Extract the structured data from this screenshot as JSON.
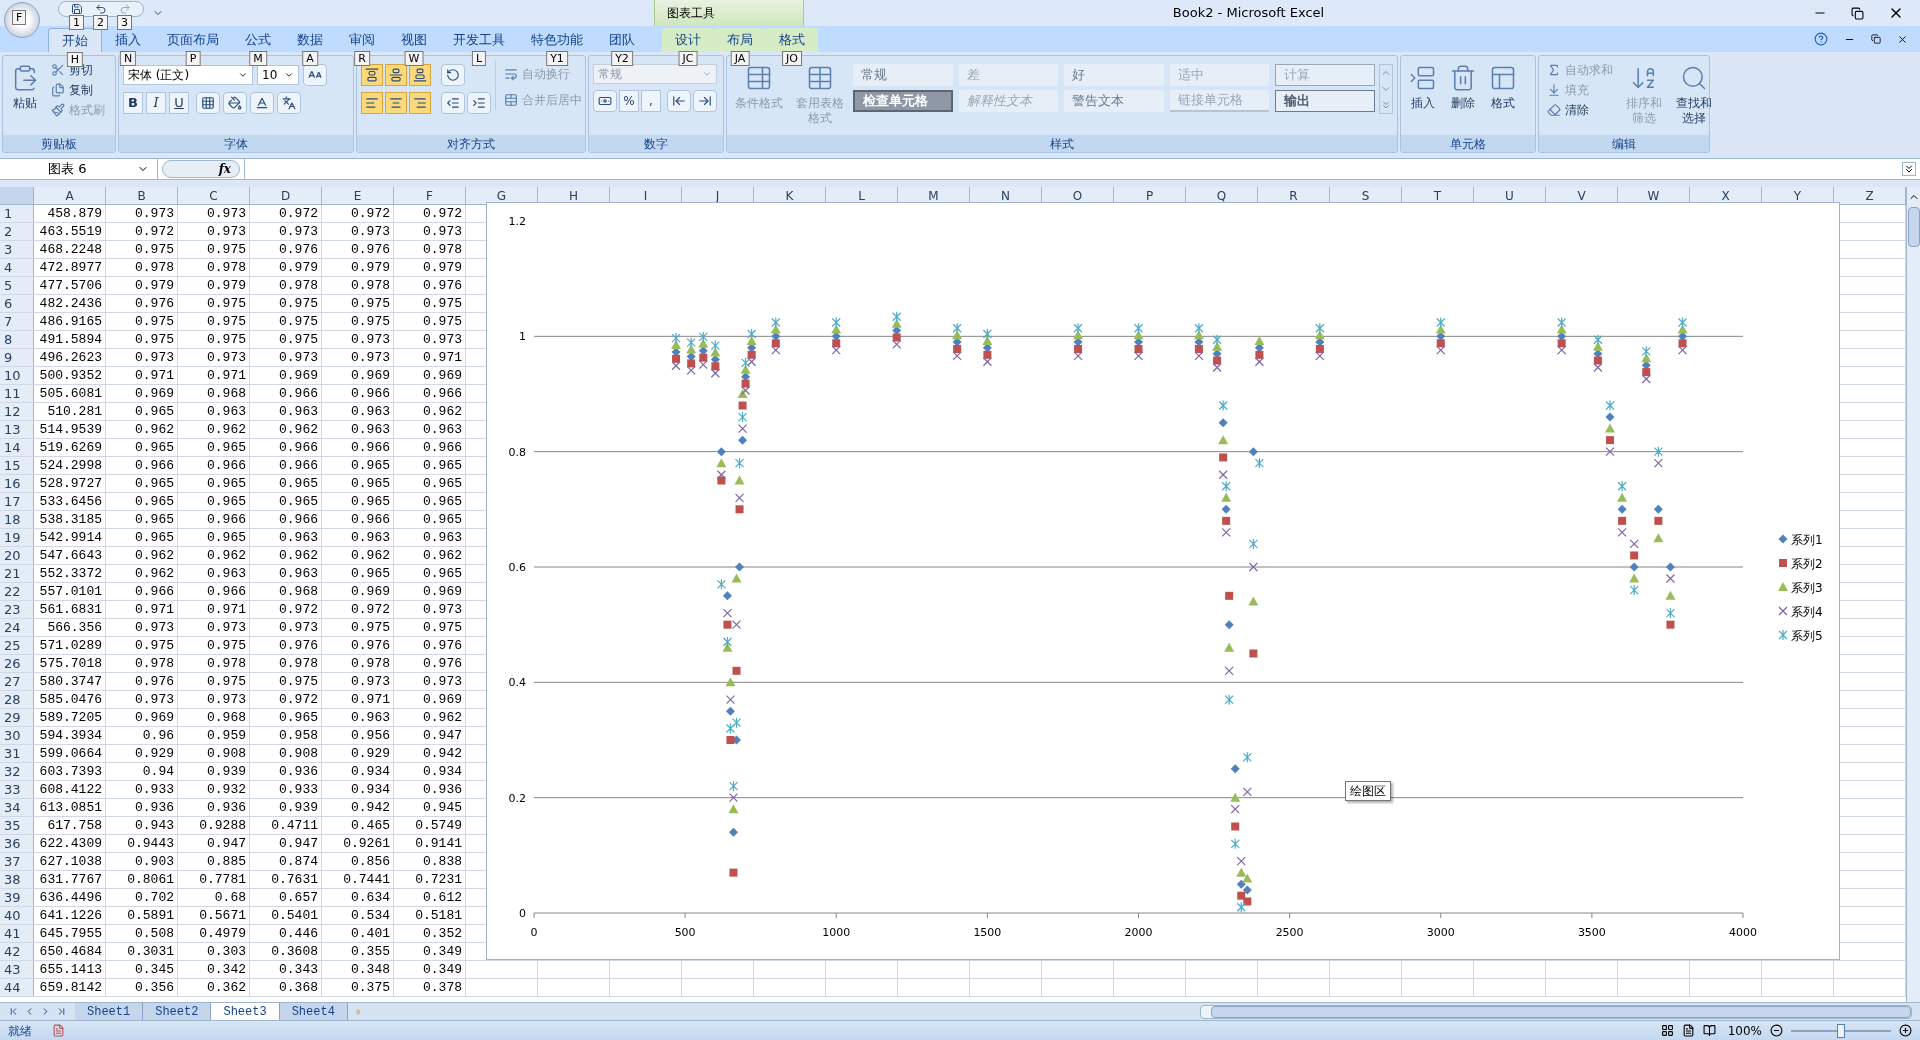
{
  "office_button": {
    "keytip": "F"
  },
  "quick_access": {
    "keytips": [
      "1",
      "2",
      "3"
    ]
  },
  "window": {
    "title": "Book2 - Microsoft Excel",
    "context_group": "图表工具"
  },
  "ribbon_tabs": [
    {
      "label": "开始",
      "keytip": "H",
      "selected": true,
      "contextual": false
    },
    {
      "label": "插入",
      "keytip": "N",
      "selected": false,
      "contextual": false
    },
    {
      "label": "页面布局",
      "keytip": "P",
      "selected": false,
      "contextual": false
    },
    {
      "label": "公式",
      "keytip": "M",
      "selected": false,
      "contextual": false
    },
    {
      "label": "数据",
      "keytip": "A",
      "selected": false,
      "contextual": false
    },
    {
      "label": "审阅",
      "keytip": "R",
      "selected": false,
      "contextual": false
    },
    {
      "label": "视图",
      "keytip": "W",
      "selected": false,
      "contextual": false
    },
    {
      "label": "开发工具",
      "keytip": "L",
      "selected": false,
      "contextual": false
    },
    {
      "label": "特色功能",
      "keytip": "Y1",
      "selected": false,
      "contextual": false
    },
    {
      "label": "团队",
      "keytip": "Y2",
      "selected": false,
      "contextual": false
    },
    {
      "label": "设计",
      "keytip": "JC",
      "selected": false,
      "contextual": true
    },
    {
      "label": "布局",
      "keytip": "JA",
      "selected": false,
      "contextual": true
    },
    {
      "label": "格式",
      "keytip": "JO",
      "selected": false,
      "contextual": true
    }
  ],
  "ribbon_groups": [
    {
      "label": "剪贴板",
      "commands": [
        {
          "label": "粘贴",
          "disabled": false
        },
        {
          "label": "剪切",
          "disabled": false
        },
        {
          "label": "复制",
          "disabled": false
        },
        {
          "label": "格式刷",
          "disabled": true
        }
      ]
    },
    {
      "label": "字体",
      "font_name": "宋体 (正文)",
      "font_size": "10",
      "commands": [
        {
          "label": "B",
          "disabled": false
        },
        {
          "label": "I",
          "disabled": false
        },
        {
          "label": "U",
          "disabled": false
        }
      ]
    },
    {
      "label": "对齐方式",
      "alignment_buttons": [
        {
          "pressed": true
        },
        {
          "pressed": true
        },
        {
          "pressed": true
        },
        {
          "pressed": true
        },
        {
          "pressed": true
        },
        {
          "pressed": true
        }
      ],
      "commands": [
        {
          "label": "自动换行",
          "disabled": true
        },
        {
          "label": "合并后居中",
          "disabled": true
        }
      ]
    },
    {
      "label": "数字",
      "number_format": "常规",
      "commands": [
        {
          "label": "%",
          "disabled": false
        },
        {
          "label": ",",
          "disabled": false
        }
      ]
    },
    {
      "label": "样式",
      "commands": [
        {
          "label": "条件格式",
          "disabled": true
        },
        {
          "label": "套用表格格式",
          "disabled": true
        }
      ],
      "cell_styles": [
        "常规",
        "差",
        "好",
        "适中",
        "计算",
        "检查单元格",
        "解释性文本",
        "警告文本",
        "链接单元格",
        "输出"
      ]
    },
    {
      "label": "单元格",
      "commands": [
        {
          "label": "插入",
          "disabled": false
        },
        {
          "label": "删除",
          "disabled": false
        },
        {
          "label": "格式",
          "disabled": false
        }
      ]
    },
    {
      "label": "编辑",
      "commands": [
        {
          "label": "自动求和",
          "disabled": true
        },
        {
          "label": "填充",
          "disabled": true
        },
        {
          "label": "清除",
          "disabled": false
        },
        {
          "label": "排序和筛选",
          "disabled": true
        },
        {
          "label": "查找和选择",
          "disabled": false
        }
      ]
    }
  ],
  "formula_bar": {
    "name_box": "图表 6",
    "function_label": "fx"
  },
  "sheet": {
    "columns": [
      "A",
      "B",
      "C",
      "D",
      "E",
      "F",
      "G",
      "H",
      "I",
      "J",
      "K",
      "L",
      "M",
      "N",
      "O",
      "P",
      "Q",
      "R",
      "S",
      "T",
      "U",
      "V",
      "W",
      "X",
      "Y",
      "Z"
    ],
    "rows": [
      {
        "number": "1",
        "cells": [
          "458.879",
          "0.973",
          "0.973",
          "0.972",
          "0.972",
          "0.972"
        ]
      },
      {
        "number": "2",
        "cells": [
          "463.5519",
          "0.972",
          "0.973",
          "0.973",
          "0.973",
          "0.973"
        ]
      },
      {
        "number": "3",
        "cells": [
          "468.2248",
          "0.975",
          "0.975",
          "0.976",
          "0.976",
          "0.978"
        ]
      },
      {
        "number": "4",
        "cells": [
          "472.8977",
          "0.978",
          "0.978",
          "0.979",
          "0.979",
          "0.979"
        ]
      },
      {
        "number": "5",
        "cells": [
          "477.5706",
          "0.979",
          "0.979",
          "0.978",
          "0.978",
          "0.976"
        ]
      },
      {
        "number": "6",
        "cells": [
          "482.2436",
          "0.976",
          "0.975",
          "0.975",
          "0.975",
          "0.975"
        ]
      },
      {
        "number": "7",
        "cells": [
          "486.9165",
          "0.975",
          "0.975",
          "0.975",
          "0.975",
          "0.975"
        ]
      },
      {
        "number": "8",
        "cells": [
          "491.5894",
          "0.975",
          "0.975",
          "0.975",
          "0.973",
          "0.973"
        ]
      },
      {
        "number": "9",
        "cells": [
          "496.2623",
          "0.973",
          "0.973",
          "0.973",
          "0.973",
          "0.971"
        ]
      },
      {
        "number": "10",
        "cells": [
          "500.9352",
          "0.971",
          "0.971",
          "0.969",
          "0.969",
          "0.969"
        ]
      },
      {
        "number": "11",
        "cells": [
          "505.6081",
          "0.969",
          "0.968",
          "0.966",
          "0.966",
          "0.966"
        ]
      },
      {
        "number": "12",
        "cells": [
          "510.281",
          "0.965",
          "0.963",
          "0.963",
          "0.963",
          "0.962"
        ]
      },
      {
        "number": "13",
        "cells": [
          "514.9539",
          "0.962",
          "0.962",
          "0.962",
          "0.963",
          "0.963"
        ]
      },
      {
        "number": "14",
        "cells": [
          "519.6269",
          "0.965",
          "0.965",
          "0.966",
          "0.966",
          "0.966"
        ]
      },
      {
        "number": "15",
        "cells": [
          "524.2998",
          "0.966",
          "0.966",
          "0.966",
          "0.965",
          "0.965"
        ]
      },
      {
        "number": "16",
        "cells": [
          "528.9727",
          "0.965",
          "0.965",
          "0.965",
          "0.965",
          "0.965"
        ]
      },
      {
        "number": "17",
        "cells": [
          "533.6456",
          "0.965",
          "0.965",
          "0.965",
          "0.965",
          "0.965"
        ]
      },
      {
        "number": "18",
        "cells": [
          "538.3185",
          "0.965",
          "0.966",
          "0.966",
          "0.966",
          "0.965"
        ]
      },
      {
        "number": "19",
        "cells": [
          "542.9914",
          "0.965",
          "0.965",
          "0.963",
          "0.963",
          "0.963"
        ]
      },
      {
        "number": "20",
        "cells": [
          "547.6643",
          "0.962",
          "0.962",
          "0.962",
          "0.962",
          "0.962"
        ]
      },
      {
        "number": "21",
        "cells": [
          "552.3372",
          "0.962",
          "0.963",
          "0.963",
          "0.965",
          "0.965"
        ]
      },
      {
        "number": "22",
        "cells": [
          "557.0101",
          "0.966",
          "0.966",
          "0.968",
          "0.969",
          "0.969"
        ]
      },
      {
        "number": "23",
        "cells": [
          "561.6831",
          "0.971",
          "0.971",
          "0.972",
          "0.972",
          "0.973"
        ]
      },
      {
        "number": "24",
        "cells": [
          "566.356",
          "0.973",
          "0.973",
          "0.973",
          "0.975",
          "0.975"
        ]
      },
      {
        "number": "25",
        "cells": [
          "571.0289",
          "0.975",
          "0.975",
          "0.976",
          "0.976",
          "0.976"
        ]
      },
      {
        "number": "26",
        "cells": [
          "575.7018",
          "0.978",
          "0.978",
          "0.978",
          "0.978",
          "0.976"
        ]
      },
      {
        "number": "27",
        "cells": [
          "580.3747",
          "0.976",
          "0.975",
          "0.975",
          "0.973",
          "0.973"
        ]
      },
      {
        "number": "28",
        "cells": [
          "585.0476",
          "0.973",
          "0.973",
          "0.972",
          "0.971",
          "0.969"
        ]
      },
      {
        "number": "29",
        "cells": [
          "589.7205",
          "0.969",
          "0.968",
          "0.965",
          "0.963",
          "0.962"
        ]
      },
      {
        "number": "30",
        "cells": [
          "594.3934",
          "0.96",
          "0.959",
          "0.958",
          "0.956",
          "0.947"
        ]
      },
      {
        "number": "31",
        "cells": [
          "599.0664",
          "0.929",
          "0.908",
          "0.908",
          "0.929",
          "0.942"
        ]
      },
      {
        "number": "32",
        "cells": [
          "603.7393",
          "0.94",
          "0.939",
          "0.936",
          "0.934",
          "0.934"
        ]
      },
      {
        "number": "33",
        "cells": [
          "608.4122",
          "0.933",
          "0.932",
          "0.933",
          "0.934",
          "0.936"
        ]
      },
      {
        "number": "34",
        "cells": [
          "613.0851",
          "0.936",
          "0.936",
          "0.939",
          "0.942",
          "0.945"
        ]
      },
      {
        "number": "35",
        "cells": [
          "617.758",
          "0.943",
          "0.9288",
          "0.4711",
          "0.465",
          "0.5749"
        ]
      },
      {
        "number": "36",
        "cells": [
          "622.4309",
          "0.9443",
          "0.947",
          "0.947",
          "0.9261",
          "0.9141"
        ]
      },
      {
        "number": "37",
        "cells": [
          "627.1038",
          "0.903",
          "0.885",
          "0.874",
          "0.856",
          "0.838"
        ]
      },
      {
        "number": "38",
        "cells": [
          "631.7767",
          "0.8061",
          "0.7781",
          "0.7631",
          "0.7441",
          "0.7231"
        ]
      },
      {
        "number": "39",
        "cells": [
          "636.4496",
          "0.702",
          "0.68",
          "0.657",
          "0.634",
          "0.612"
        ]
      },
      {
        "number": "40",
        "cells": [
          "641.1226",
          "0.5891",
          "0.5671",
          "0.5401",
          "0.534",
          "0.5181"
        ]
      },
      {
        "number": "41",
        "cells": [
          "645.7955",
          "0.508",
          "0.4979",
          "0.446",
          "0.401",
          "0.352"
        ]
      },
      {
        "number": "42",
        "cells": [
          "650.4684",
          "0.3031",
          "0.303",
          "0.3608",
          "0.355",
          "0.349"
        ]
      },
      {
        "number": "43",
        "cells": [
          "655.1413",
          "0.345",
          "0.342",
          "0.343",
          "0.348",
          "0.349"
        ]
      },
      {
        "number": "44",
        "cells": [
          "659.8142",
          "0.356",
          "0.362",
          "0.368",
          "0.375",
          "0.378"
        ]
      }
    ]
  },
  "chart": {
    "tooltip": "绘图区",
    "chart_data": {
      "type": "scatter",
      "xlim": [
        0,
        4000
      ],
      "ylim": [
        0,
        1.2
      ],
      "grid": true,
      "legend": true,
      "xticks": [
        0,
        500,
        1000,
        1500,
        2000,
        2500,
        3000,
        3500,
        4000
      ],
      "yticks": [
        0,
        0.2,
        0.4,
        0.6,
        0.8,
        1,
        1.2
      ],
      "x": [
        470,
        520,
        560,
        600,
        620,
        640,
        650,
        660,
        670,
        680,
        690,
        700,
        720,
        800,
        1000,
        1200,
        1400,
        1500,
        1800,
        2000,
        2200,
        2260,
        2280,
        2290,
        2300,
        2320,
        2340,
        2360,
        2380,
        2400,
        2600,
        3000,
        3400,
        3520,
        3560,
        3600,
        3640,
        3680,
        3720,
        3760,
        3800
      ],
      "series": [
        {
          "name": "系列1",
          "color": "#4f81bd",
          "values": [
            0.973,
            0.965,
            0.975,
            0.96,
            0.8,
            0.55,
            0.35,
            0.14,
            0.3,
            0.6,
            0.82,
            0.93,
            0.98,
            1.0,
            1.0,
            1.01,
            0.99,
            0.98,
            0.99,
            0.99,
            0.99,
            0.97,
            0.85,
            0.7,
            0.5,
            0.25,
            0.05,
            0.04,
            0.8,
            0.98,
            0.99,
            1.0,
            1.0,
            0.97,
            0.86,
            0.7,
            0.6,
            0.95,
            0.7,
            0.6,
            1.0
          ]
        },
        {
          "name": "系列2",
          "color": "#c0504d",
          "values": [
            0.961,
            0.953,
            0.963,
            0.948,
            0.75,
            0.5,
            0.3,
            0.07,
            0.42,
            0.7,
            0.88,
            0.918,
            0.968,
            0.988,
            0.988,
            0.998,
            0.978,
            0.968,
            0.978,
            0.978,
            0.978,
            0.958,
            0.79,
            0.68,
            0.55,
            0.15,
            0.03,
            0.02,
            0.45,
            0.968,
            0.978,
            0.988,
            0.988,
            0.958,
            0.82,
            0.68,
            0.62,
            0.938,
            0.68,
            0.5,
            0.988
          ]
        },
        {
          "name": "系列3",
          "color": "#9bbb59",
          "values": [
            0.985,
            0.977,
            0.987,
            0.972,
            0.78,
            0.46,
            0.4,
            0.18,
            0.58,
            0.75,
            0.9,
            0.942,
            0.992,
            1.012,
            1.012,
            1.022,
            1.002,
            0.992,
            1.002,
            1.002,
            1.002,
            0.982,
            0.82,
            0.72,
            0.46,
            0.2,
            0.07,
            0.06,
            0.54,
            0.992,
            1.002,
            1.012,
            1.012,
            0.982,
            0.84,
            0.72,
            0.58,
            0.962,
            0.65,
            0.55,
            1.012
          ]
        },
        {
          "name": "系列4",
          "color": "#8064a2",
          "values": [
            0.949,
            0.941,
            0.951,
            0.936,
            0.76,
            0.52,
            0.37,
            0.2,
            0.5,
            0.72,
            0.84,
            0.906,
            0.956,
            0.976,
            0.976,
            0.986,
            0.966,
            0.956,
            0.966,
            0.966,
            0.966,
            0.946,
            0.76,
            0.66,
            0.42,
            0.18,
            0.09,
            0.21,
            0.6,
            0.956,
            0.966,
            0.976,
            0.976,
            0.946,
            0.8,
            0.66,
            0.64,
            0.926,
            0.78,
            0.58,
            0.976
          ]
        },
        {
          "name": "系列5",
          "color": "#4bacc6",
          "values": [
            0.997,
            0.989,
            0.999,
            0.984,
            0.57,
            0.47,
            0.32,
            0.22,
            0.33,
            0.78,
            0.86,
            0.954,
            1.004,
            1.024,
            1.024,
            1.034,
            1.014,
            1.004,
            1.014,
            1.014,
            1.014,
            0.994,
            0.88,
            0.74,
            0.37,
            0.12,
            0.01,
            0.27,
            0.64,
            0.78,
            1.014,
            1.024,
            1.024,
            0.994,
            0.88,
            0.74,
            0.56,
            0.974,
            0.8,
            0.52,
            1.024
          ]
        }
      ]
    }
  },
  "sheet_tabs": [
    {
      "label": "Sheet1",
      "selected": false
    },
    {
      "label": "Sheet2",
      "selected": false
    },
    {
      "label": "Sheet3",
      "selected": true
    },
    {
      "label": "Sheet4",
      "selected": false
    }
  ],
  "status_bar": {
    "status": "就绪",
    "zoom": {
      "reading": "100%",
      "level": 0.5
    }
  }
}
